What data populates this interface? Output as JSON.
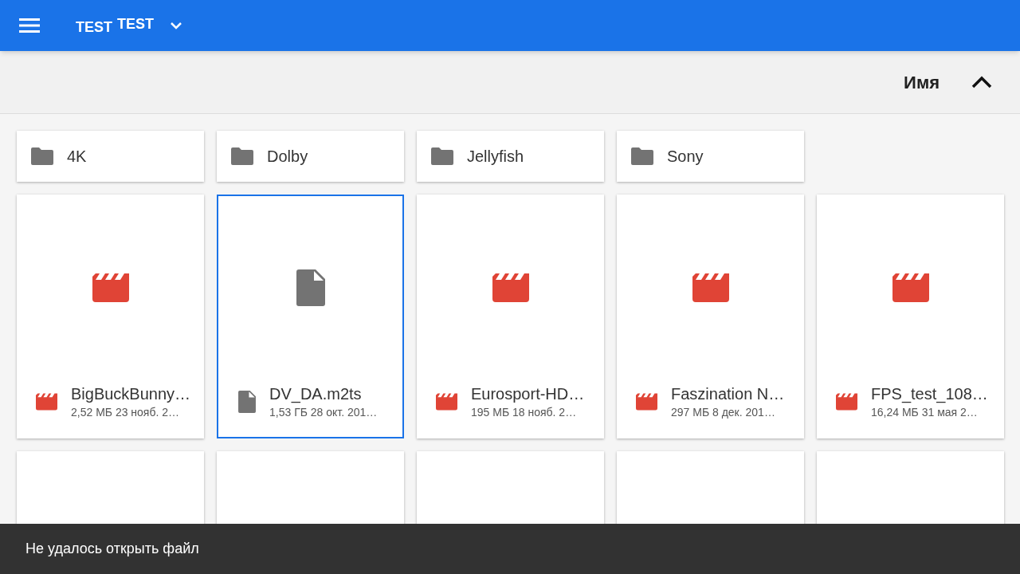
{
  "app_bar": {
    "title_small": "TEST",
    "title": "TEST"
  },
  "sort_bar": {
    "label": "Имя",
    "ascending": true
  },
  "folders": [
    {
      "name": "4K"
    },
    {
      "name": "Dolby"
    },
    {
      "name": "Jellyfish"
    },
    {
      "name": "Sony"
    }
  ],
  "files": [
    {
      "kind": "video",
      "name": "BigBuckBunny…",
      "meta": "2,52 МБ 23 нояб. 2…",
      "selected": false
    },
    {
      "kind": "document",
      "name": "DV_DA.m2ts",
      "meta": "1,53 ГБ 28 окт. 201…",
      "selected": true
    },
    {
      "kind": "video",
      "name": "Eurosport-HD…",
      "meta": "195 МБ 18 нояб. 2…",
      "selected": false
    },
    {
      "kind": "video",
      "name": "Faszination N…",
      "meta": "297 МБ 8 дек. 201…",
      "selected": false
    },
    {
      "kind": "video",
      "name": "FPS_test_108…",
      "meta": "16,24 МБ 31 мая 2…",
      "selected": false
    }
  ],
  "snackbar": {
    "message": "Не удалось открыть файл"
  }
}
